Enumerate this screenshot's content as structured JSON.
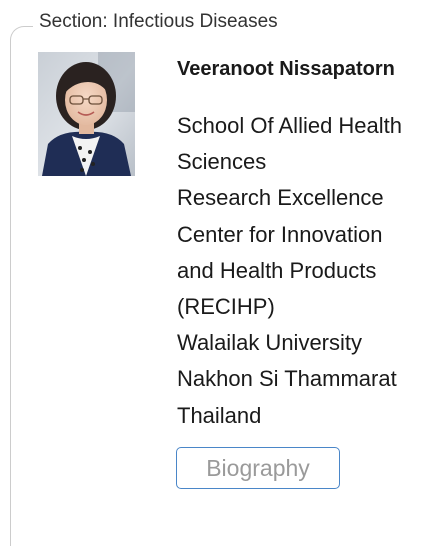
{
  "section": {
    "label": "Section: Infectious Diseases"
  },
  "editor": {
    "photo_icon": "portrait-photo",
    "name": "Veeranoot Nissapatorn",
    "affiliation_lines": [
      "School Of Allied Health",
      "Sciences",
      "Research Excellence",
      "Center for Innovation",
      "and Health Products",
      "(RECIHP)",
      "Walailak University",
      "Nakhon Si Thammarat",
      "Thailand"
    ],
    "biography_label": "Biography"
  },
  "colors": {
    "button_border": "#4a86c8",
    "button_text": "#9a9a9a",
    "frame_line": "#cccccc"
  }
}
